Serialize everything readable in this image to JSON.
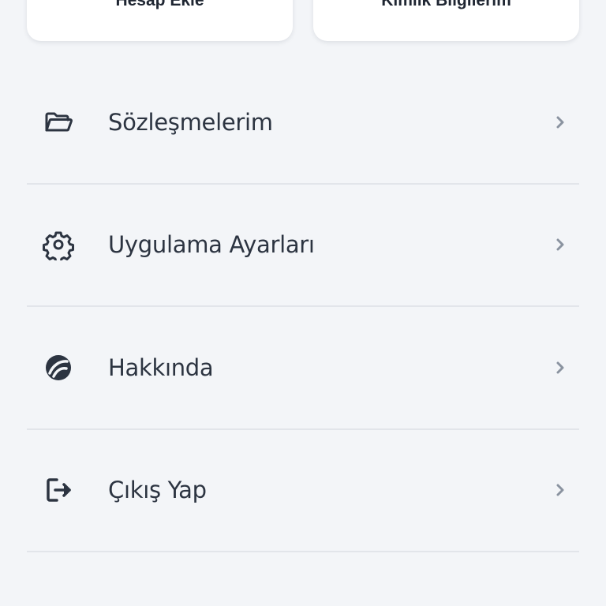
{
  "top_cards": [
    {
      "label": "Hesap Ekle"
    },
    {
      "label": "Kimlik Bilgilerim"
    }
  ],
  "menu": {
    "items": [
      {
        "label": "Sözleşmelerim",
        "icon": "folder-icon"
      },
      {
        "label": "Uygulama Ayarları",
        "icon": "gear-icon"
      },
      {
        "label": "Hakkında",
        "icon": "brand-logo-icon"
      },
      {
        "label": "Çıkış Yap",
        "icon": "logout-icon"
      }
    ]
  },
  "colors": {
    "background": "#f3f5f8",
    "card": "#ffffff",
    "text": "#2c3441",
    "divider": "#e2e5ea",
    "chevron": "#8a93a0"
  }
}
